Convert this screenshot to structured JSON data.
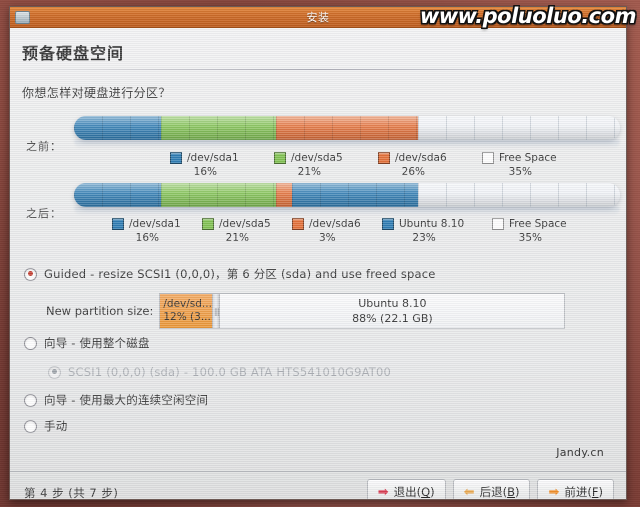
{
  "window": {
    "title": "安装",
    "icon": "window-menu-icon"
  },
  "page": {
    "heading": "预备硬盘空间",
    "question": "你想怎样对硬盘进行分区？"
  },
  "watermarks": {
    "top": "www.poluoluo.com",
    "bottom": "Jandy.cn"
  },
  "colors": {
    "sda1": "#2878b0",
    "sda5": "#7cbf4c",
    "sda6": "#e26b32",
    "ubuntu": "#2878b0",
    "free": "#eef1f5",
    "titlebar": "#d2702b",
    "radio_selected": "#c0392b"
  },
  "chart_data": [
    {
      "type": "bar",
      "title": "之前：",
      "orientation": "horizontal-stacked",
      "categories": [
        "/dev/sda1",
        "/dev/sda5",
        "/dev/sda6",
        "Free Space"
      ],
      "values": [
        16,
        21,
        26,
        35
      ],
      "value_labels": [
        "16%",
        "21%",
        "26%",
        "35%"
      ],
      "colors": [
        "#2878b0",
        "#7cbf4c",
        "#e26b32",
        "#eef1f5"
      ],
      "xlabel": "",
      "ylabel": "",
      "total": 100
    },
    {
      "type": "bar",
      "title": "之后：",
      "orientation": "horizontal-stacked",
      "categories": [
        "/dev/sda1",
        "/dev/sda5",
        "/dev/sda6",
        "Ubuntu 8.10",
        "Free Space"
      ],
      "values": [
        16,
        21,
        3,
        23,
        35
      ],
      "value_labels": [
        "16%",
        "21%",
        "3%",
        "23%",
        "35%"
      ],
      "colors": [
        "#2878b0",
        "#7cbf4c",
        "#e26b32",
        "#2878b0",
        "#eef1f5"
      ],
      "xlabel": "",
      "ylabel": "",
      "total": 98
    }
  ],
  "bars": [
    {
      "label": "之前：",
      "segments": [
        {
          "name": "/dev/sda1",
          "percent": 16,
          "percent_label": "16%",
          "color": "#2878b0",
          "free": false
        },
        {
          "name": "/dev/sda5",
          "percent": 21,
          "percent_label": "21%",
          "color": "#7cbf4c",
          "free": false
        },
        {
          "name": "/dev/sda6",
          "percent": 26,
          "percent_label": "26%",
          "color": "#e26b32",
          "free": false
        },
        {
          "name": "Free Space",
          "percent": 37,
          "percent_label": "35%",
          "color": "#eef1f5",
          "free": true
        }
      ]
    },
    {
      "label": "之后：",
      "segments": [
        {
          "name": "/dev/sda1",
          "percent": 16,
          "percent_label": "16%",
          "color": "#2878b0",
          "free": false
        },
        {
          "name": "/dev/sda5",
          "percent": 21,
          "percent_label": "21%",
          "color": "#7cbf4c",
          "free": false
        },
        {
          "name": "/dev/sda6",
          "percent": 3,
          "percent_label": "3%",
          "color": "#e26b32",
          "free": false
        },
        {
          "name": "Ubuntu 8.10",
          "percent": 23,
          "percent_label": "23%",
          "color": "#2878b0",
          "free": false
        },
        {
          "name": "Free Space",
          "percent": 37,
          "percent_label": "35%",
          "color": "#eef1f5",
          "free": true
        }
      ]
    }
  ],
  "options": {
    "guided_resize": {
      "label": "Guided - resize SCSI1 (0,0,0)，第 6 分区 (sda) and use freed space",
      "selected": true
    },
    "size_row": {
      "label": "New partition size:",
      "left_line1": "/dev/sd...",
      "left_line2": "12% (3...",
      "right_line1": "Ubuntu 8.10",
      "right_line2": "88% (22.1 GB)"
    },
    "whole_disk": {
      "label": "向导 - 使用整个磁盘",
      "selected": false
    },
    "disk_entry": {
      "label": "SCSI1 (0,0,0) (sda) - 100.0 GB ATA HTS541010G9AT00",
      "selected": true,
      "disabled": true
    },
    "largest_free": {
      "label": "向导 - 使用最大的连续空闲空间",
      "selected": false
    },
    "manual": {
      "label": "手动",
      "selected": false
    }
  },
  "footer": {
    "step": "第 4 步 (共 7 步)",
    "buttons": [
      {
        "name": "quit",
        "text": "退出(",
        "mnemonic": "Q",
        "tail": ")",
        "glyph": "➡",
        "glyph_color": "#d6354b"
      },
      {
        "name": "back",
        "text": "后退(",
        "mnemonic": "B",
        "tail": ")",
        "glyph": "⬅",
        "glyph_color": "#e8a54a"
      },
      {
        "name": "forward",
        "text": "前进(",
        "mnemonic": "F",
        "tail": ")",
        "glyph": "➡",
        "glyph_color": "#ef8a22"
      }
    ]
  }
}
